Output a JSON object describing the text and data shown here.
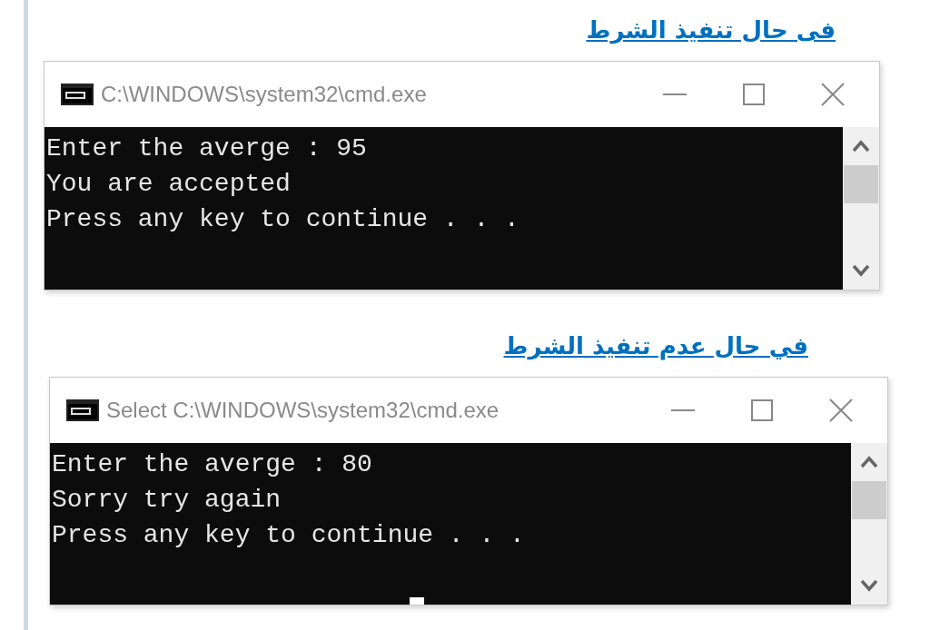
{
  "sections": [
    {
      "heading": "فی حال تنفيذ الشرط",
      "window": {
        "title": "C:\\WINDOWS\\system32\\cmd.exe",
        "lines": [
          "Enter the averge : 95",
          "You are accepted",
          "Press any key to continue . . ."
        ],
        "cursor": false
      }
    },
    {
      "heading": "في حال عدم تنفيذ الشرط",
      "window": {
        "title": "Select C:\\WINDOWS\\system32\\cmd.exe",
        "lines": [
          "Enter the averge : 80",
          "Sorry try again",
          "Press any key to continue . . ."
        ],
        "cursor": true
      }
    }
  ]
}
